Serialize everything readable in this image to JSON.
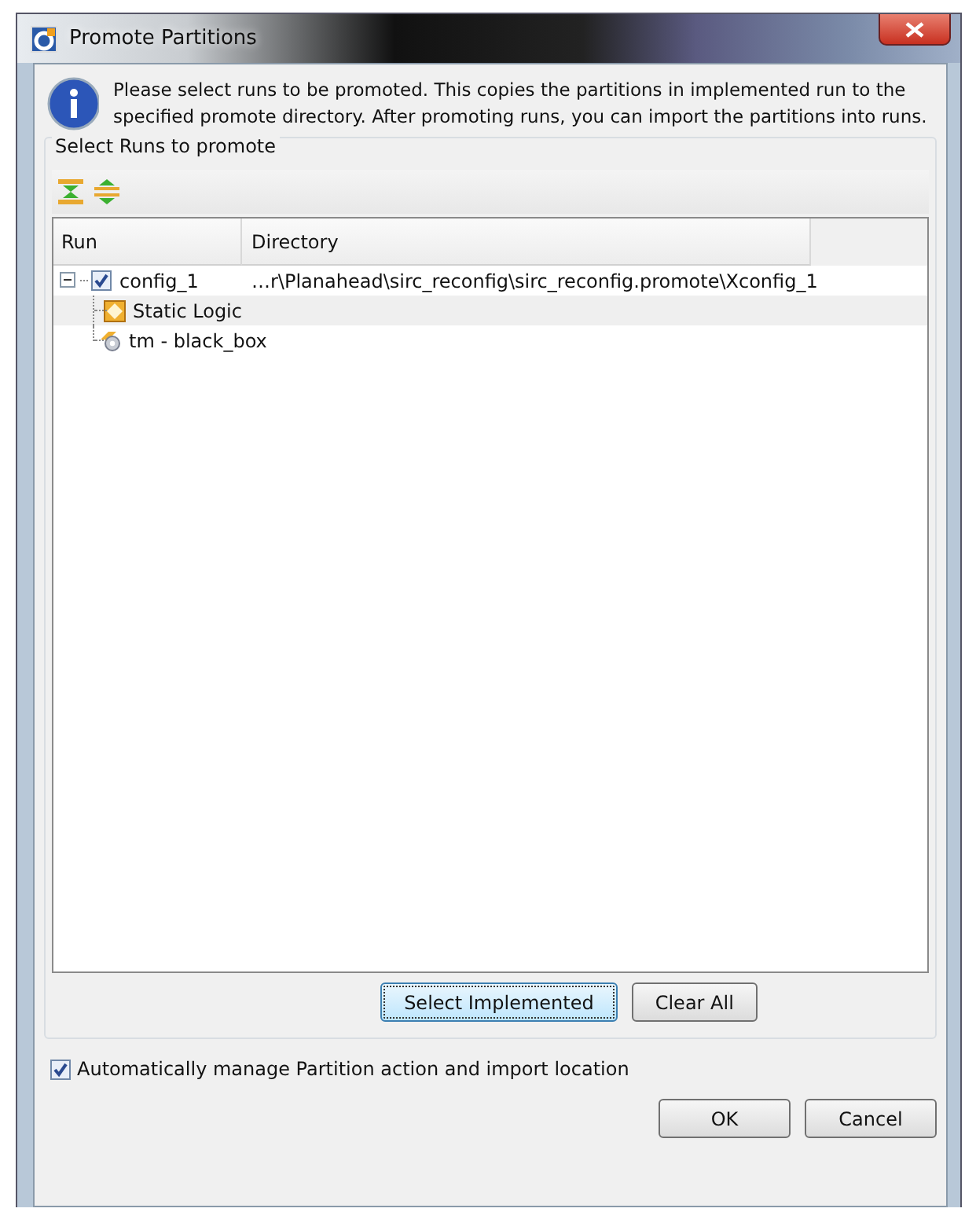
{
  "window": {
    "title": "Promote Partitions"
  },
  "info": {
    "message": "Please select runs to be promoted. This copies the partitions in implemented run to the specified promote directory. After promoting runs, you can import the partitions into runs."
  },
  "group": {
    "title": "Select Runs to promote"
  },
  "table": {
    "columns": [
      "Run",
      "Directory"
    ],
    "rows": [
      {
        "kind": "run",
        "name": "config_1",
        "directory": "…r\\Planahead\\sirc_reconfig\\sirc_reconfig.promote\\Xconfig_1",
        "expanded": true,
        "checked": true,
        "selected": false,
        "children": [
          {
            "kind": "static",
            "name": "Static Logic",
            "selected": true
          },
          {
            "kind": "blackbox",
            "name": "tm - black_box",
            "selected": false
          }
        ]
      }
    ]
  },
  "table_buttons": [
    {
      "label": "Select Implemented",
      "focused": true
    },
    {
      "label": "Clear All",
      "focused": false
    }
  ],
  "auto_manage": {
    "label": "Automatically manage Partition action and import location",
    "checked": true
  },
  "buttons": [
    "OK",
    "Cancel"
  ]
}
